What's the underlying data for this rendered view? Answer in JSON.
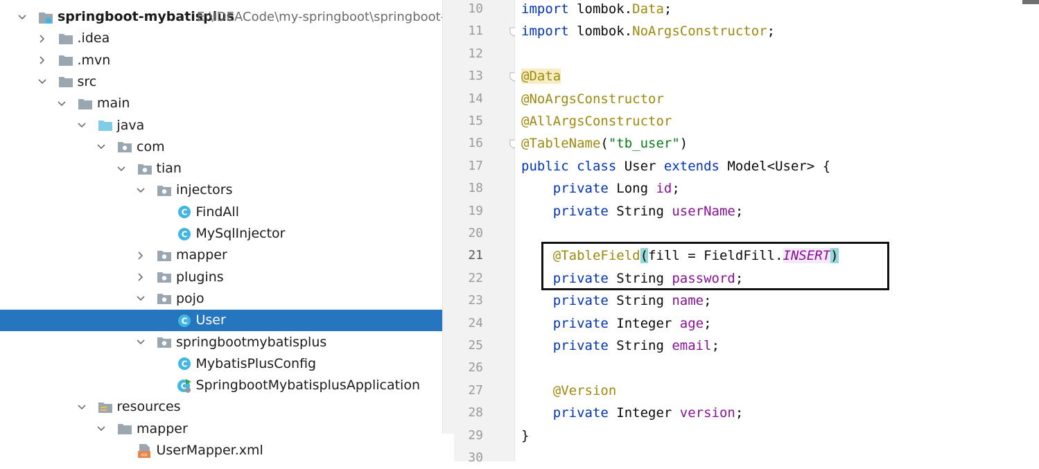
{
  "project": {
    "name": "springboot-mybatisplus",
    "path": "E:\\IDEACode\\my-springboot\\springboot-m"
  },
  "tree": [
    {
      "label": "springboot-mybatisplus",
      "indent": 0,
      "arrow": "down",
      "icon": "project-module-icon",
      "bold": true
    },
    {
      "label": ".idea",
      "indent": 1,
      "arrow": "right",
      "icon": "folder-icon"
    },
    {
      "label": ".mvn",
      "indent": 1,
      "arrow": "right",
      "icon": "folder-icon"
    },
    {
      "label": "src",
      "indent": 1,
      "arrow": "down",
      "icon": "folder-icon"
    },
    {
      "label": "main",
      "indent": 2,
      "arrow": "down",
      "icon": "folder-icon"
    },
    {
      "label": "java",
      "indent": 3,
      "arrow": "down",
      "icon": "source-folder-icon"
    },
    {
      "label": "com",
      "indent": 4,
      "arrow": "down",
      "icon": "package-icon"
    },
    {
      "label": "tian",
      "indent": 5,
      "arrow": "down",
      "icon": "package-icon"
    },
    {
      "label": "injectors",
      "indent": 6,
      "arrow": "down",
      "icon": "package-icon"
    },
    {
      "label": "FindAll",
      "indent": 7,
      "arrow": "",
      "icon": "class-icon"
    },
    {
      "label": "MySqlInjector",
      "indent": 7,
      "arrow": "",
      "icon": "class-icon"
    },
    {
      "label": "mapper",
      "indent": 6,
      "arrow": "right",
      "icon": "package-icon"
    },
    {
      "label": "plugins",
      "indent": 6,
      "arrow": "right",
      "icon": "package-icon"
    },
    {
      "label": "pojo",
      "indent": 6,
      "arrow": "down",
      "icon": "package-icon"
    },
    {
      "label": "User",
      "indent": 7,
      "arrow": "",
      "icon": "class-icon",
      "selected": true
    },
    {
      "label": "springbootmybatisplus",
      "indent": 6,
      "arrow": "down",
      "icon": "package-icon"
    },
    {
      "label": "MybatisPlusConfig",
      "indent": 7,
      "arrow": "",
      "icon": "class-icon"
    },
    {
      "label": "SpringbootMybatisplusApplication",
      "indent": 7,
      "arrow": "",
      "icon": "spring-boot-class-icon"
    },
    {
      "label": "resources",
      "indent": 3,
      "arrow": "down",
      "icon": "resources-folder-icon"
    },
    {
      "label": "mapper",
      "indent": 4,
      "arrow": "down",
      "icon": "folder-icon"
    },
    {
      "label": "UserMapper.xml",
      "indent": 5,
      "arrow": "",
      "icon": "xml-file-icon"
    }
  ],
  "editor": {
    "current_line": 21,
    "lines": [
      {
        "n": "10",
        "tokens": [
          {
            "t": "import",
            "c": "kw"
          },
          {
            "t": " lombok."
          },
          {
            "t": "Data",
            "c": "ann"
          },
          {
            "t": ";"
          }
        ]
      },
      {
        "n": "11",
        "fold": true,
        "tokens": [
          {
            "t": "import",
            "c": "kw"
          },
          {
            "t": " lombok."
          },
          {
            "t": "NoArgsConstructor",
            "c": "ann"
          },
          {
            "t": ";"
          }
        ]
      },
      {
        "n": "12",
        "tokens": []
      },
      {
        "n": "13",
        "fold": true,
        "tokens": [
          {
            "t": "@Data",
            "c": "ann hlann"
          }
        ]
      },
      {
        "n": "14",
        "tokens": [
          {
            "t": "@NoArgsConstructor",
            "c": "ann"
          }
        ]
      },
      {
        "n": "15",
        "tokens": [
          {
            "t": "@AllArgsConstructor",
            "c": "ann"
          }
        ]
      },
      {
        "n": "16",
        "fold": true,
        "tokens": [
          {
            "t": "@TableName",
            "c": "ann"
          },
          {
            "t": "("
          },
          {
            "t": "\"tb_user\"",
            "c": "str"
          },
          {
            "t": ")"
          }
        ]
      },
      {
        "n": "17",
        "tokens": [
          {
            "t": "public class",
            "c": "kw"
          },
          {
            "t": " User "
          },
          {
            "t": "extends",
            "c": "kw"
          },
          {
            "t": " Model<User> {"
          }
        ]
      },
      {
        "n": "18",
        "tokens": [
          {
            "t": "    "
          },
          {
            "t": "private",
            "c": "kw"
          },
          {
            "t": " Long "
          },
          {
            "t": "id",
            "c": "fld"
          },
          {
            "t": ";"
          }
        ]
      },
      {
        "n": "19",
        "tokens": [
          {
            "t": "    "
          },
          {
            "t": "private",
            "c": "kw"
          },
          {
            "t": " String "
          },
          {
            "t": "userName",
            "c": "fld"
          },
          {
            "t": ";"
          }
        ]
      },
      {
        "n": "20",
        "tokens": []
      },
      {
        "n": "21",
        "tokens": [
          {
            "t": "    "
          },
          {
            "t": "@TableField",
            "c": "ann"
          },
          {
            "t": "(",
            "c": "brc"
          },
          {
            "t": "fill = FieldFill."
          },
          {
            "t": "INSERT",
            "c": "cst"
          },
          {
            "t": ")",
            "c": "brc"
          }
        ]
      },
      {
        "n": "22",
        "tokens": [
          {
            "t": "    "
          },
          {
            "t": "private",
            "c": "kw"
          },
          {
            "t": " String "
          },
          {
            "t": "password",
            "c": "fld"
          },
          {
            "t": ";"
          }
        ]
      },
      {
        "n": "23",
        "tokens": [
          {
            "t": "    "
          },
          {
            "t": "private",
            "c": "kw"
          },
          {
            "t": " String "
          },
          {
            "t": "name",
            "c": "fld"
          },
          {
            "t": ";"
          }
        ]
      },
      {
        "n": "24",
        "tokens": [
          {
            "t": "    "
          },
          {
            "t": "private",
            "c": "kw"
          },
          {
            "t": " Integer "
          },
          {
            "t": "age",
            "c": "fld"
          },
          {
            "t": ";"
          }
        ]
      },
      {
        "n": "25",
        "tokens": [
          {
            "t": "    "
          },
          {
            "t": "private",
            "c": "kw"
          },
          {
            "t": " String "
          },
          {
            "t": "email",
            "c": "fld"
          },
          {
            "t": ";"
          }
        ]
      },
      {
        "n": "26",
        "tokens": []
      },
      {
        "n": "27",
        "tokens": [
          {
            "t": "    "
          },
          {
            "t": "@Version",
            "c": "ann"
          }
        ]
      },
      {
        "n": "28",
        "tokens": [
          {
            "t": "    "
          },
          {
            "t": "private",
            "c": "kw"
          },
          {
            "t": " Integer "
          },
          {
            "t": "version",
            "c": "fld"
          },
          {
            "t": ";"
          }
        ]
      },
      {
        "n": "29",
        "tokens": [
          {
            "t": "}"
          }
        ]
      },
      {
        "n": "30",
        "tokens": []
      }
    ]
  }
}
